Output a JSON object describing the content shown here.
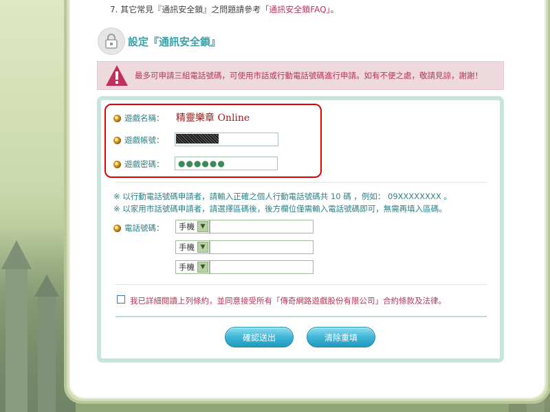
{
  "faq": {
    "prefix": "7. 其它常見『通訊安全鎖』之問題請參考",
    "link": "「通訊安全鎖FAQ」",
    "suffix": "。"
  },
  "section": {
    "title": "設定『通訊安全鎖』"
  },
  "warning": {
    "text": "最多可申請三組電話號碼，可使用市話或行動電話號碼進行申請。如有不便之處，敬請見諒，謝謝！"
  },
  "account": {
    "game_name_label": "遊戲名稱：",
    "game_name": "精靈樂章 Online",
    "game_account_label": "遊戲帳號：",
    "game_password_label": "遊戲密碼：",
    "password_dots": "●●●●●●"
  },
  "notices": {
    "mobile": "※ 以行動電話號碼申請者，請輸入正確之個人行動電話號碼共 10 碼 ，例如： 09XXXXXXXX 。",
    "landline": "※ 以家用市話號碼申請者，請選擇區碼後，後方欄位僅需輸入電話號碼即可，無需再填入區碼。"
  },
  "phone": {
    "label": "電話號碼：",
    "rows": [
      {
        "type": "手機"
      },
      {
        "type": "手機"
      },
      {
        "type": "手機"
      }
    ]
  },
  "agreement": {
    "text": "我已詳細閱讀上列條約，並同意接受所有「傳奇網路遊戲股份有限公司」合約條款及法律。"
  },
  "buttons": {
    "submit": "確認送出",
    "reset": "清除重填"
  },
  "colors": {
    "accent_teal": "#3aa0a8",
    "warning_text": "#b1395a",
    "highlight_red": "#e00000",
    "button_blue": "#3fb6d6"
  }
}
